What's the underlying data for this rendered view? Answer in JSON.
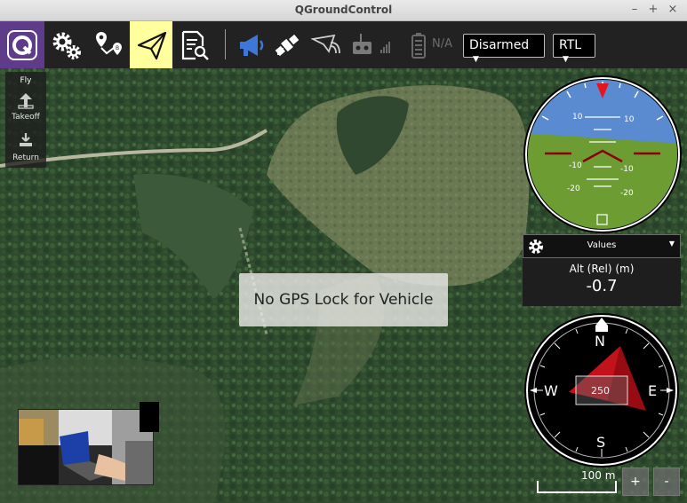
{
  "window": {
    "title": "QGroundControl",
    "controls": {
      "minimize": "–",
      "maximize": "+",
      "close": "×"
    }
  },
  "toolbar": {
    "buttons": [
      {
        "name": "qgc-logo-icon"
      },
      {
        "name": "settings-gears-icon"
      },
      {
        "name": "plan-view-icon"
      },
      {
        "name": "fly-view-icon",
        "active": true
      },
      {
        "name": "analyze-view-icon"
      }
    ],
    "status_icons": [
      "megaphone-icon",
      "gps-satellite-icon",
      "telemetry-plane-icon",
      "rc-transmitter-icon",
      "battery-icon"
    ],
    "battery_label": "N/A",
    "armed_dropdown": "Disarmed",
    "mode_dropdown": "RTL",
    "active_color": "#ffff9e",
    "accent_color": "#5e3c8a"
  },
  "fly_panel": {
    "title": "Fly",
    "takeoff_label": "Takeoff",
    "return_label": "Return"
  },
  "message": {
    "text": "No GPS Lock for Vehicle"
  },
  "attitude": {
    "pitch_labels_top": [
      "10",
      "10"
    ],
    "pitch_labels_bottom": [
      "-10",
      "-10",
      "-20",
      "-20"
    ]
  },
  "values": {
    "title": "Values",
    "label": "Alt (Rel) (m)",
    "value": "-0.7"
  },
  "compass": {
    "north": "N",
    "south": "S",
    "east": "E",
    "west": "W",
    "heading": "250"
  },
  "map": {
    "scale_label": "100 m",
    "zoom_in": "+",
    "zoom_out": "-"
  }
}
